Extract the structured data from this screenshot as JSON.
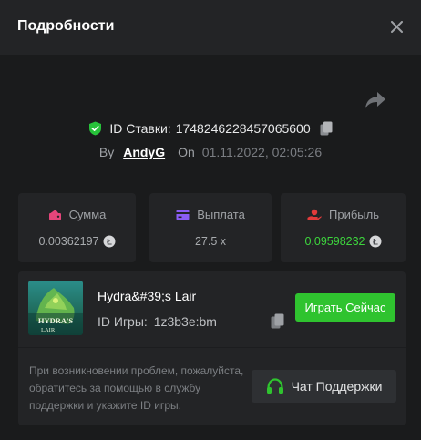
{
  "header": {
    "title": "Подробности",
    "close_icon": "close-icon"
  },
  "bet": {
    "id_label": "ID Ставки:",
    "id_value": "1748246228457065600",
    "by_label": "By",
    "user": "AndyG",
    "on_label": "On",
    "date": "01.11.2022, 02:05:26"
  },
  "stats": [
    {
      "label": "Сумма",
      "value": "0.00362197",
      "icon": "wallet-icon",
      "color": "#e5457a",
      "coin": true
    },
    {
      "label": "Выплата",
      "value": "27.5 x",
      "icon": "card-icon",
      "color": "#8b5cf6",
      "coin": false
    },
    {
      "label": "Прибыль",
      "value": "0.09598232",
      "icon": "profit-hand-icon",
      "color": "#e23b3b",
      "coin": true
    }
  ],
  "game": {
    "name": "Hydra&#39;s Lair",
    "id_label": "ID Игры:",
    "id_value": "1z3b3e:bm",
    "thumb_text_line1": "HYDRA'S",
    "thumb_text_line2": "LAIR",
    "play_label": "Играть Сейчас",
    "help_text": "При возникновении проблем, пожалуйста, обратитесь за помощью в службу поддержки и укажите ID игры.",
    "support_label": "Чат Поддержки"
  },
  "colors": {
    "accent_green": "#2fc32f",
    "profit_green": "#3dd53d",
    "shield_green": "#27c23a"
  }
}
